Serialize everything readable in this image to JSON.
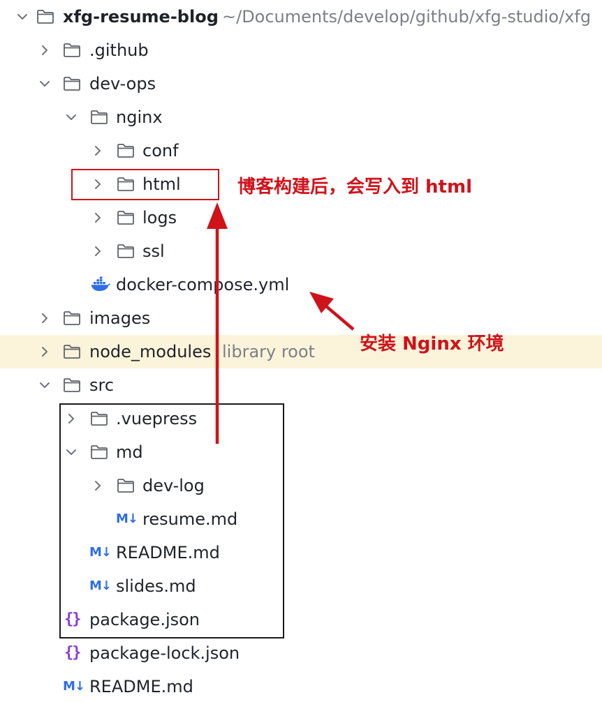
{
  "tree": {
    "root": {
      "name": "xfg-resume-blog",
      "path": "~/Documents/develop/github/xfg-studio/xfg"
    },
    "items": [
      {
        "name": ".github"
      },
      {
        "name": "dev-ops"
      },
      {
        "name": "nginx"
      },
      {
        "name": "conf"
      },
      {
        "name": "html"
      },
      {
        "name": "logs"
      },
      {
        "name": "ssl"
      },
      {
        "name": "docker-compose.yml"
      },
      {
        "name": "images"
      },
      {
        "name": "node_modules",
        "hint": "library root"
      },
      {
        "name": "src"
      },
      {
        "name": ".vuepress"
      },
      {
        "name": "md"
      },
      {
        "name": "dev-log"
      },
      {
        "name": "resume.md"
      },
      {
        "name": "README.md"
      },
      {
        "name": "slides.md"
      },
      {
        "name": "package.json"
      },
      {
        "name": "package-lock.json"
      },
      {
        "name": "README.md"
      }
    ]
  },
  "icons": {
    "markdown": "M↓",
    "json": "{}"
  },
  "annotations": {
    "html_note": "博客构建后，会写入到 html",
    "nginx_note": "安装 Nginx 环境"
  },
  "colors": {
    "annotation": "#d0121b",
    "highlight_row": "#fcf4da",
    "markdown_icon": "#2f6ee6",
    "json_icon": "#8a3ad9",
    "docker_icon": "#2f6ee6"
  }
}
